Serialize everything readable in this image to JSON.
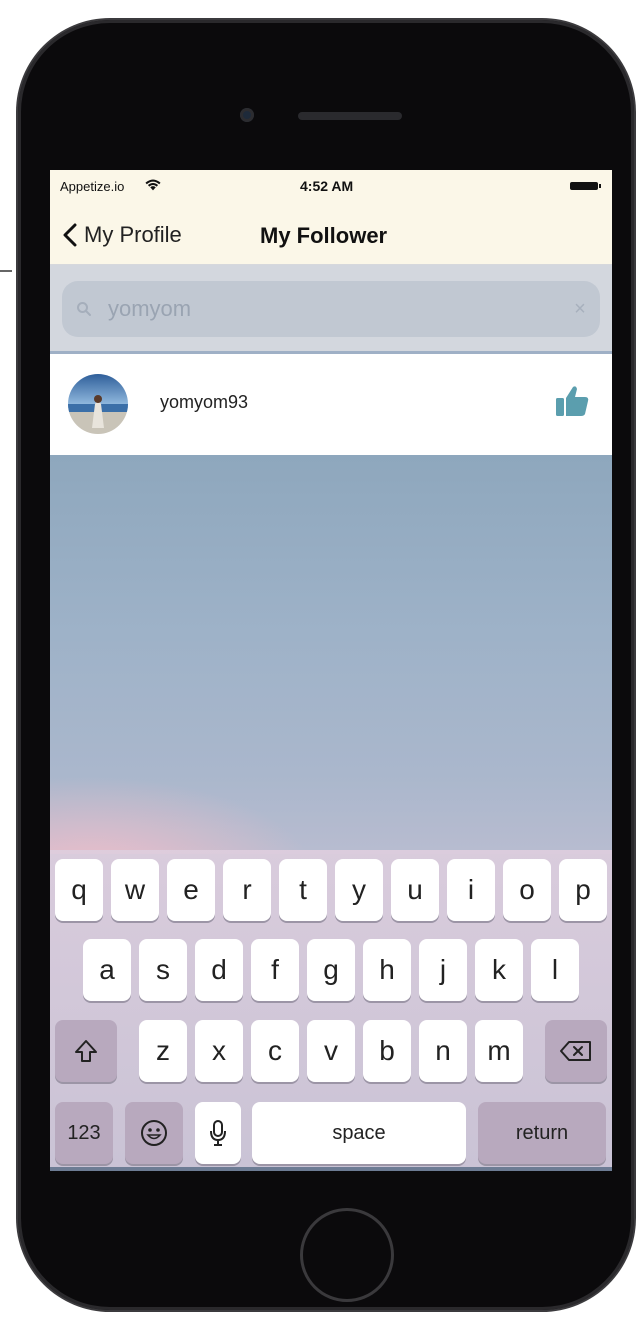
{
  "status_bar": {
    "carrier": "Appetize.io",
    "time": "4:52 AM",
    "wifi_icon": "wifi-icon",
    "battery_icon": "battery-icon"
  },
  "nav": {
    "back_label": "My Profile",
    "title": "My Follower"
  },
  "search": {
    "value": "yomyom",
    "clear_icon": "×"
  },
  "followers": [
    {
      "username": "yomyom93",
      "liked": true
    }
  ],
  "keyboard": {
    "row1": [
      "q",
      "w",
      "e",
      "r",
      "t",
      "y",
      "u",
      "i",
      "o",
      "p"
    ],
    "row2": [
      "a",
      "s",
      "d",
      "f",
      "g",
      "h",
      "j",
      "k",
      "l"
    ],
    "row3": [
      "z",
      "x",
      "c",
      "v",
      "b",
      "n",
      "m"
    ],
    "numbers_label": "123",
    "space_label": "space",
    "return_label": "return"
  },
  "colors": {
    "nav_bg": "#fbf7e8",
    "like_icon": "#5b9eae"
  }
}
